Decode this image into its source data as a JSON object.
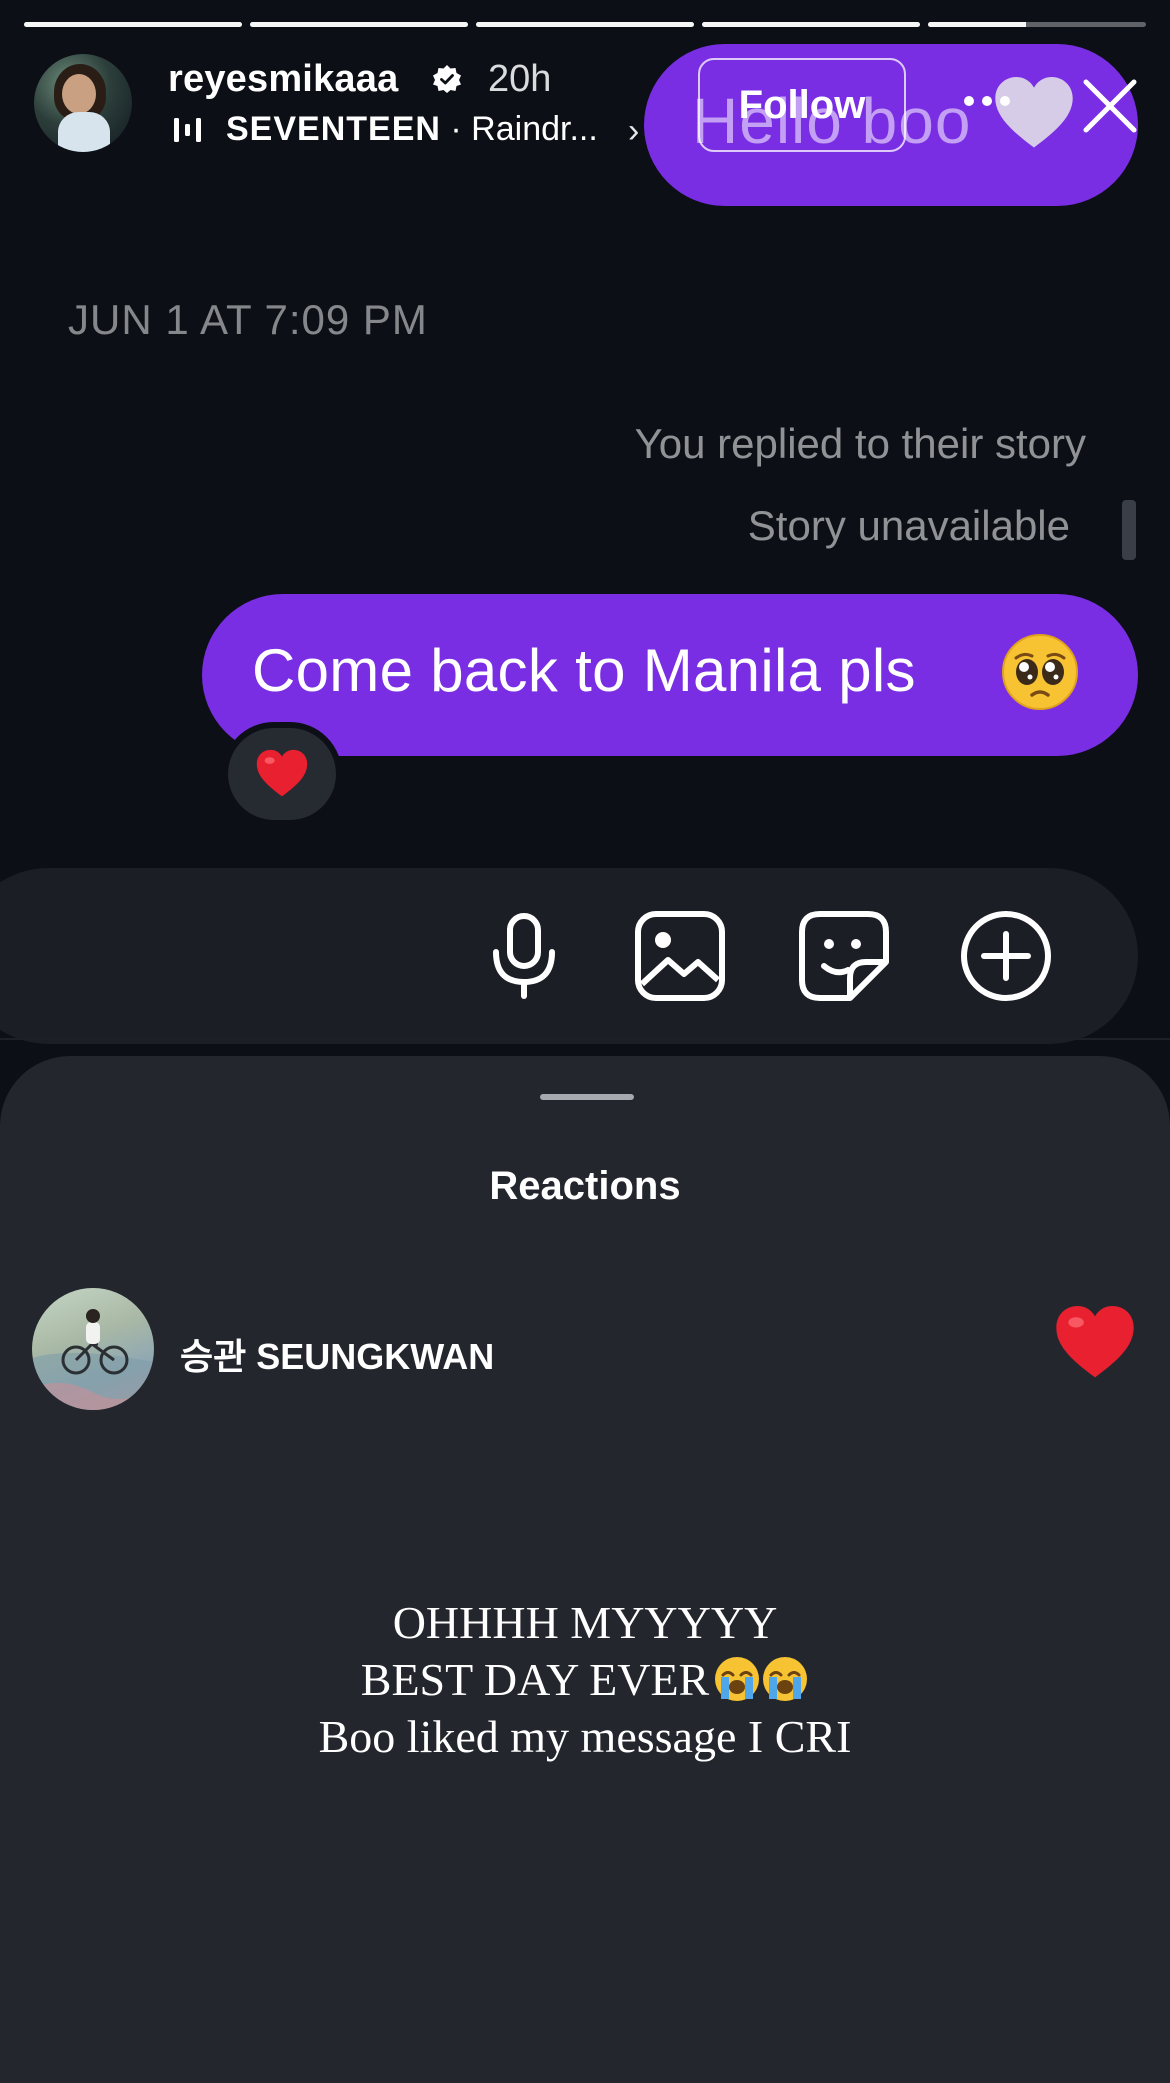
{
  "story": {
    "progress": [
      1,
      1,
      1,
      1,
      0.45
    ]
  },
  "header": {
    "username": "reyesmikaaa",
    "time_ago": "20h",
    "music_artist": "SEVENTEEN",
    "music_separator": " · ",
    "music_song": "Raindr...",
    "music_chevron": "›",
    "follow_label": "Follow",
    "icons": [
      "verified-badge-icon",
      "music-bars-icon",
      "more-icon",
      "close-icon"
    ]
  },
  "sticker": {
    "text": "Hello boo",
    "emoji": "white-heart"
  },
  "chat": {
    "date_stamp": "JUN 1 AT 7:09 PM",
    "replied_note": "You replied to their story",
    "story_status": "Story unavailable",
    "message": "Come back to Manila pls",
    "message_emoji": "pleading-face",
    "reaction": "red-heart"
  },
  "composer": {
    "icons": [
      "microphone-icon",
      "gallery-icon",
      "sticker-icon",
      "add-circle-icon"
    ]
  },
  "sheet": {
    "title": "Reactions",
    "reactions": [
      {
        "name": "승관 SEUNGKWAN",
        "emoji": "red-heart"
      }
    ]
  },
  "caption": {
    "line1": "OHHHH MYYYYY",
    "line2": "BEST DAY EVER",
    "line2_emoji": "loudly-crying-face x2",
    "line3": "Boo liked my message I CRI"
  },
  "colors": {
    "background": "#0c0f16",
    "bubble": "#7a2ee4",
    "sheet": "#23262d",
    "composer": "#1b1e24",
    "heart": "#e8202f"
  }
}
